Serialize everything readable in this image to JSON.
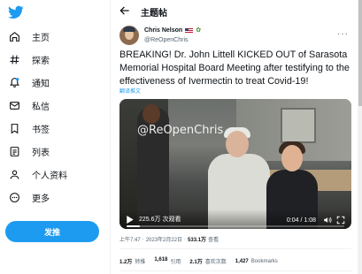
{
  "colors": {
    "accent": "#1d9bf0",
    "text": "#0f1419",
    "muted": "#536471"
  },
  "sidebar": {
    "logo_icon": "twitter-bird-icon",
    "items": [
      {
        "label": "主页",
        "icon": "home-icon"
      },
      {
        "label": "探索",
        "icon": "hashtag-icon"
      },
      {
        "label": "通知",
        "icon": "bell-icon"
      },
      {
        "label": "私信",
        "icon": "mail-icon"
      },
      {
        "label": "书签",
        "icon": "bookmark-icon"
      },
      {
        "label": "列表",
        "icon": "list-icon"
      },
      {
        "label": "个人资料",
        "icon": "person-icon"
      },
      {
        "label": "更多",
        "icon": "more-circle-icon"
      }
    ],
    "tweet_button_label": "发推"
  },
  "header": {
    "title": "主题帖",
    "back_icon": "arrow-left-icon"
  },
  "tweet": {
    "author": {
      "display_name": "Chris Nelson",
      "handle": "@ReOpenChris"
    },
    "text": "BREAKING! Dr. John Littell KICKED OUT of Sarasota Memorial Hospital Board Meeting after testifying to the effectiveness of Ivermectin to treat Covid-19!",
    "translate_label": "翻译推文",
    "video": {
      "watermark": "@ReOpenChris",
      "views": "225.6万 次观看",
      "time": "0:04 / 1:08",
      "progress": 0.06
    },
    "meta": {
      "time": "上午7:47",
      "date": "2023年2月22日",
      "views_count": "533.1万",
      "views_label": "查看"
    },
    "stats": [
      {
        "num": "1.2万",
        "label": "转推"
      },
      {
        "num": "1,618",
        "label": "引用"
      },
      {
        "num": "2.1万",
        "label": "喜欢次数"
      },
      {
        "num": "1,427",
        "label": "Bookmarks"
      }
    ]
  }
}
